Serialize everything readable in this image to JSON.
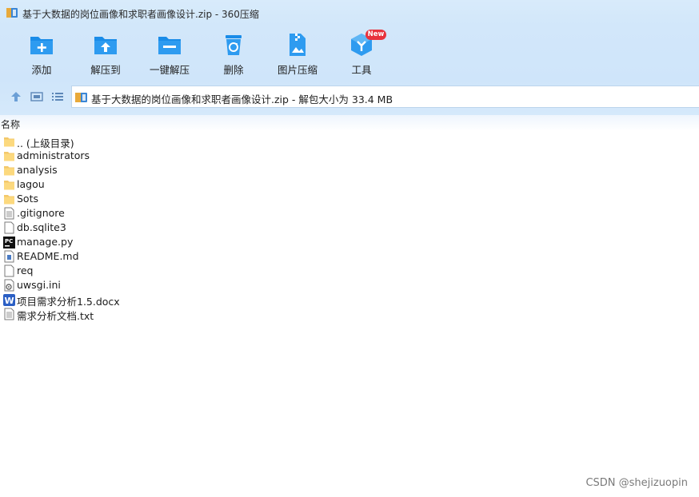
{
  "window": {
    "title": "基于大数据的岗位画像和求职者画像设计.zip - 360压缩"
  },
  "toolbar": {
    "items": [
      {
        "label": "添加",
        "icon": "add-folder-icon"
      },
      {
        "label": "解压到",
        "icon": "extract-to-icon"
      },
      {
        "label": "一键解压",
        "icon": "one-click-extract-icon"
      },
      {
        "label": "删除",
        "icon": "recycle-bin-icon"
      },
      {
        "label": "图片压缩",
        "icon": "image-compress-icon"
      },
      {
        "label": "工具",
        "icon": "tools-cube-icon",
        "badge": "New"
      }
    ],
    "accent": "#1a8ce8"
  },
  "nav": {
    "address": "基于大数据的岗位画像和求职者画像设计.zip - 解包大小为 33.4 MB"
  },
  "filelist": {
    "column_name": "名称",
    "items": [
      {
        "name": ".. (上级目录)",
        "type": "folder"
      },
      {
        "name": "administrators",
        "type": "folder"
      },
      {
        "name": "analysis",
        "type": "folder"
      },
      {
        "name": "lagou",
        "type": "folder"
      },
      {
        "name": "Sots",
        "type": "folder"
      },
      {
        "name": ".gitignore",
        "type": "text"
      },
      {
        "name": "db.sqlite3",
        "type": "blank"
      },
      {
        "name": "manage.py",
        "type": "pycharm"
      },
      {
        "name": "README.md",
        "type": "markdown"
      },
      {
        "name": "req",
        "type": "blank"
      },
      {
        "name": "uwsgi.ini",
        "type": "ini"
      },
      {
        "name": "项目需求分析1.5.docx",
        "type": "word"
      },
      {
        "name": "需求分析文档.txt",
        "type": "text"
      }
    ]
  },
  "watermark": "CSDN @shejizuopin"
}
